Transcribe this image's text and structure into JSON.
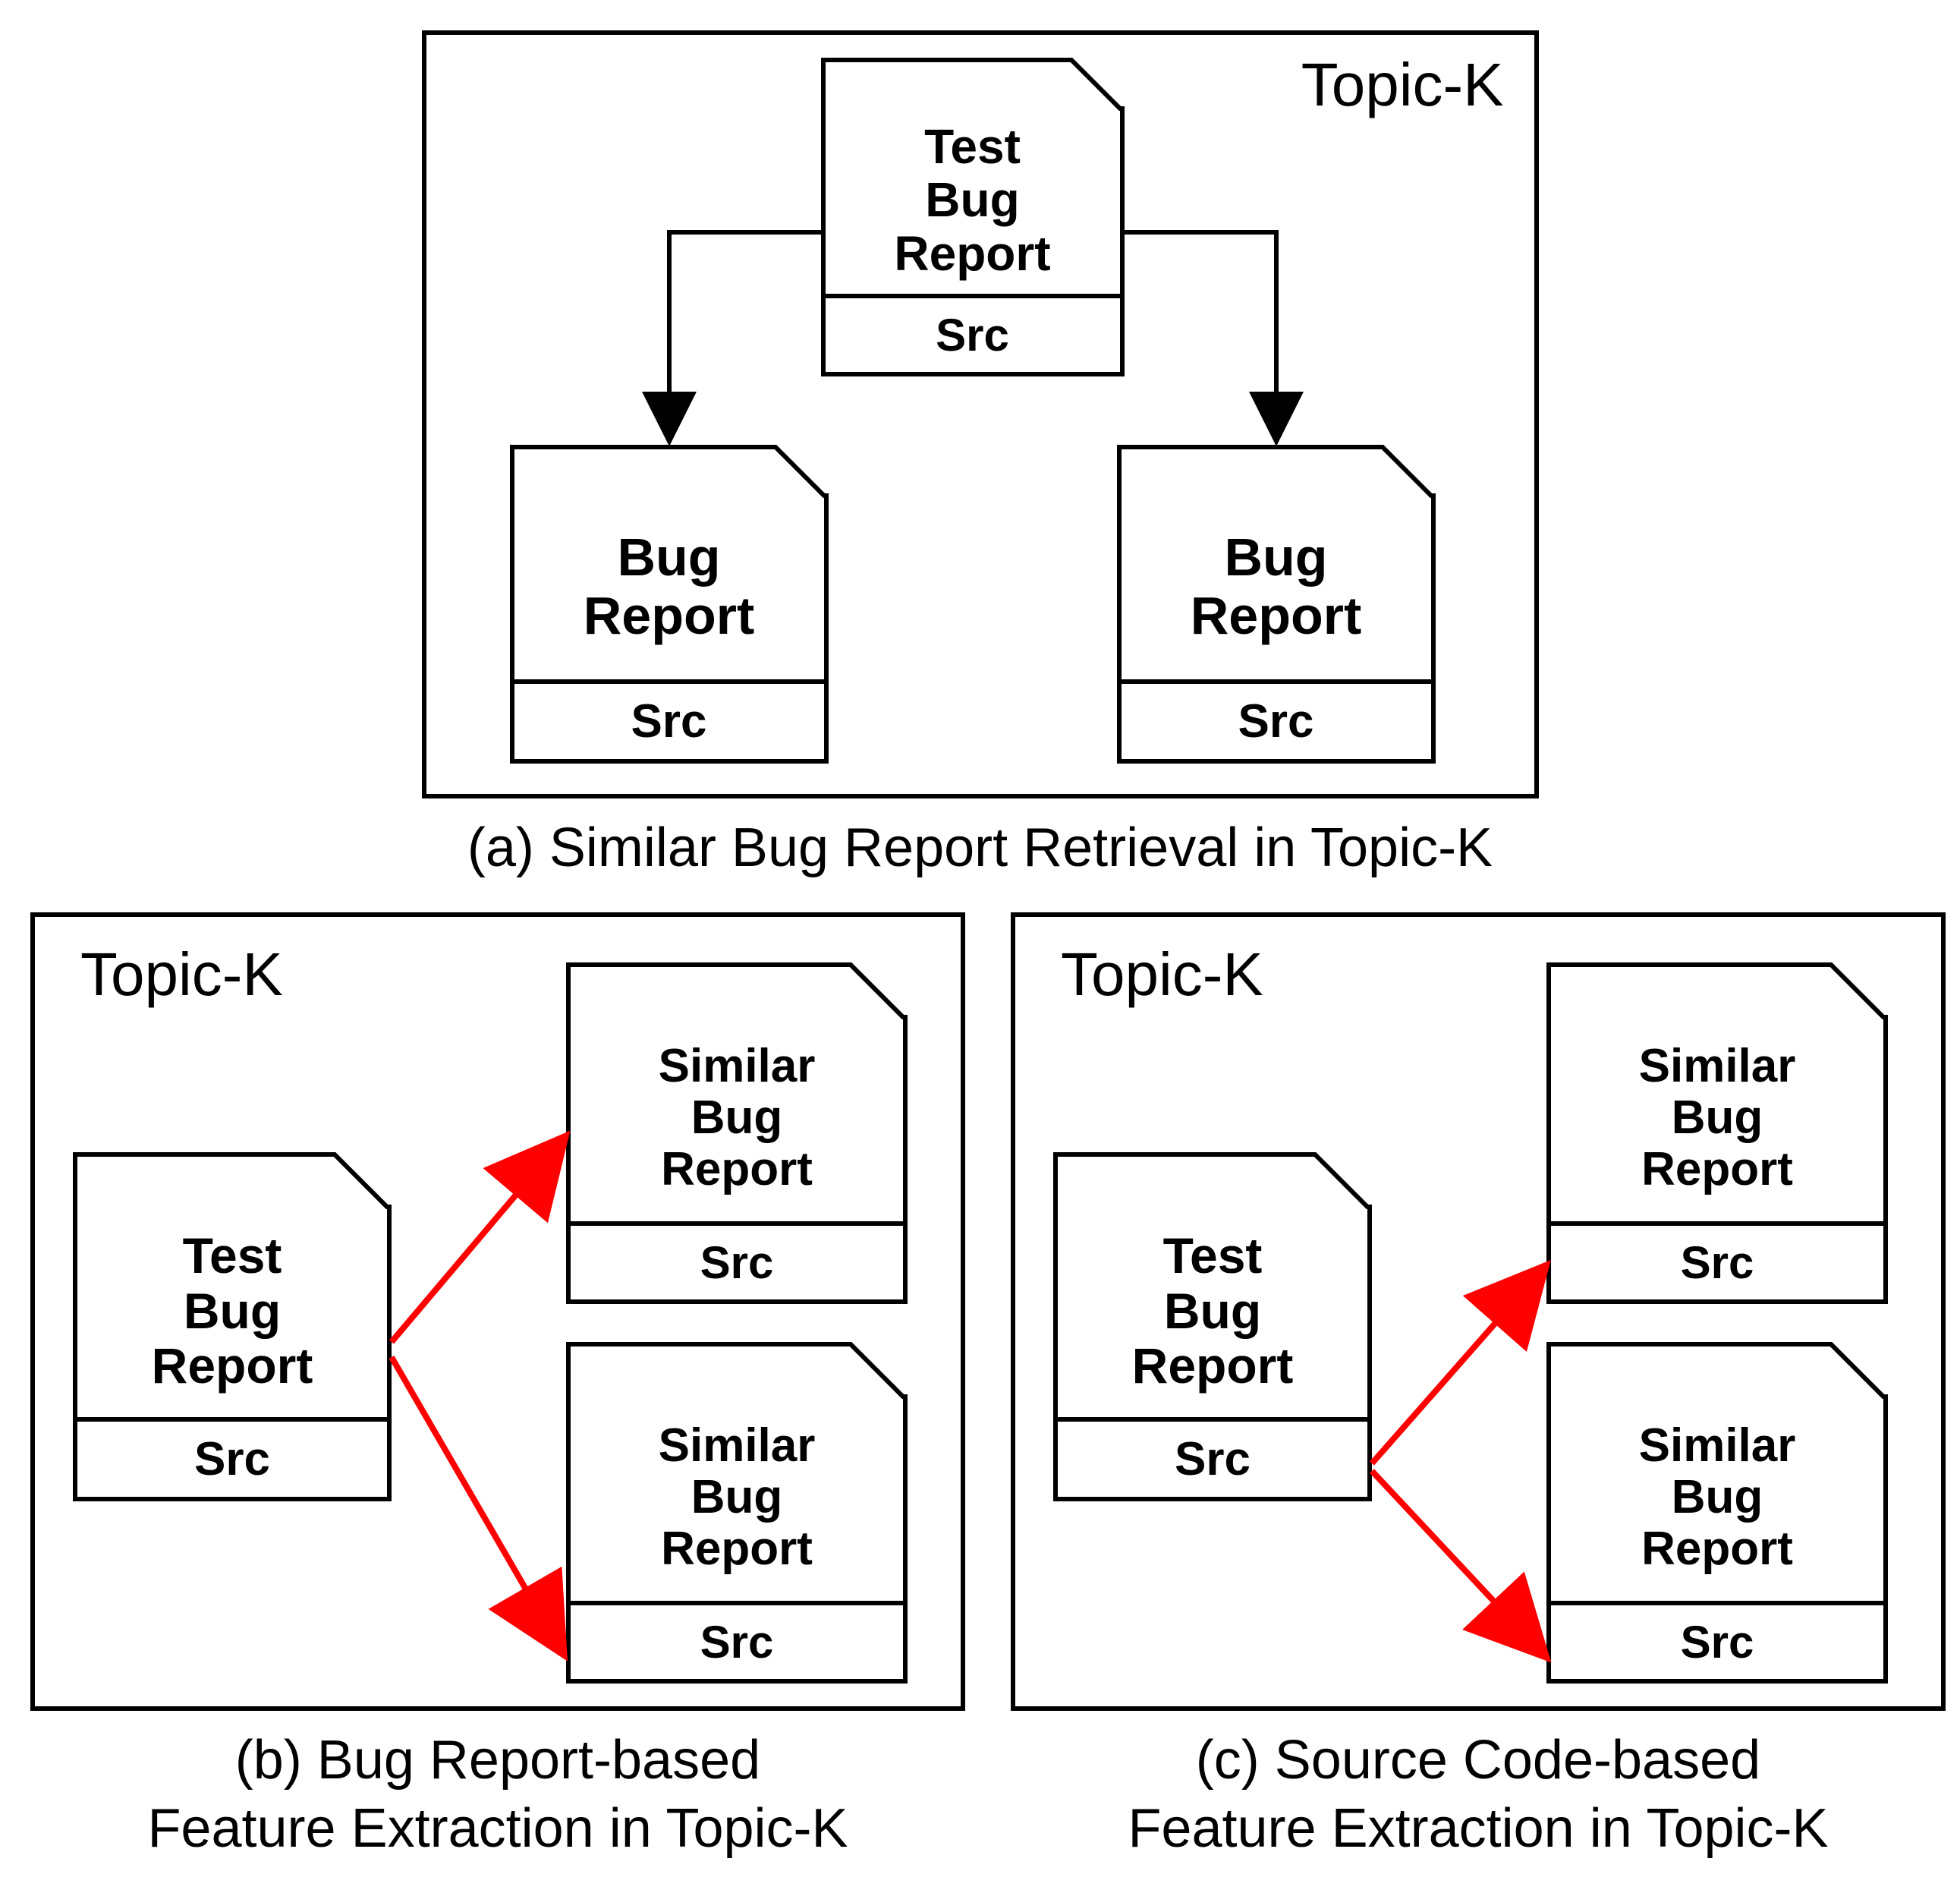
{
  "topic_label": "Topic-K",
  "src_label": "Src",
  "docs": {
    "test_bug_report": "Test\nBug\nReport",
    "bug_report": "Bug\nReport",
    "similar_bug_report": "Similar\nBug\nReport"
  },
  "captions": {
    "a": "(a) Similar Bug Report Retrieval in Topic-K",
    "b": "(b) Bug Report-based\nFeature Extraction in Topic-K",
    "c": "(c) Source Code-based\nFeature Extraction in Topic-K"
  },
  "arrow_colors": {
    "black": "#000000",
    "red": "#ff0000"
  }
}
